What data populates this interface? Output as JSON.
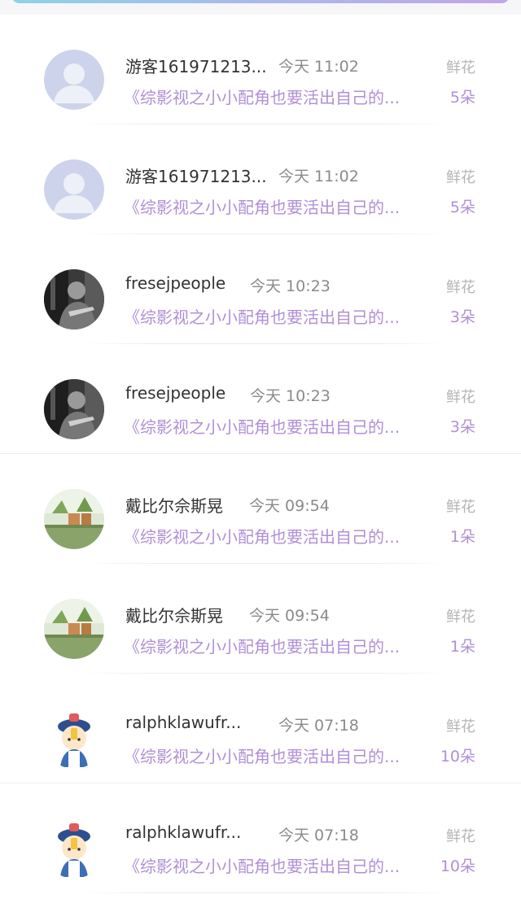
{
  "gift_list": {
    "items": [
      {
        "avatar": "default-avatar",
        "user_name": "游客161971213...",
        "time": "今天 11:02",
        "gift_type": "鲜花",
        "book_title": "《综影视之小小配角也要活出自己的...",
        "count": "5朵"
      },
      {
        "avatar": "default-avatar",
        "user_name": "游客161971213...",
        "time": "今天 11:02",
        "gift_type": "鲜花",
        "book_title": "《综影视之小小配角也要活出自己的...",
        "count": "5朵"
      },
      {
        "avatar": "photo-avatar-bw",
        "user_name": "fresejpeople",
        "time": "今天 10:23",
        "gift_type": "鲜花",
        "book_title": "《综影视之小小配角也要活出自己的...",
        "count": "3朵"
      },
      {
        "avatar": "photo-avatar-bw",
        "user_name": "fresejpeople",
        "time": "今天 10:23",
        "gift_type": "鲜花",
        "book_title": "《综影视之小小配角也要活出自己的...",
        "count": "3朵"
      },
      {
        "avatar": "photo-avatar-plants",
        "user_name": "戴比尔佘斯晃",
        "time": "今天 09:54",
        "gift_type": "鲜花",
        "book_title": "《综影视之小小配角也要活出自己的...",
        "count": "1朵"
      },
      {
        "avatar": "photo-avatar-plants",
        "user_name": "戴比尔佘斯晃",
        "time": "今天 09:54",
        "gift_type": "鲜花",
        "book_title": "《综影视之小小配角也要活出自己的...",
        "count": "1朵"
      },
      {
        "avatar": "cartoon-avatar",
        "user_name": "ralphklawufr...",
        "time": "今天 07:18",
        "gift_type": "鲜花",
        "book_title": "《综影视之小小配角也要活出自己的...",
        "count": "10朵"
      },
      {
        "avatar": "cartoon-avatar",
        "user_name": "ralphklawufr...",
        "time": "今天 07:18",
        "gift_type": "鲜花",
        "book_title": "《综影视之小小配角也要活出自己的...",
        "count": "10朵"
      }
    ]
  },
  "colors": {
    "accent_purple": "#b08fd6",
    "name_text": "#333333",
    "meta_text": "#8a8a8a"
  }
}
